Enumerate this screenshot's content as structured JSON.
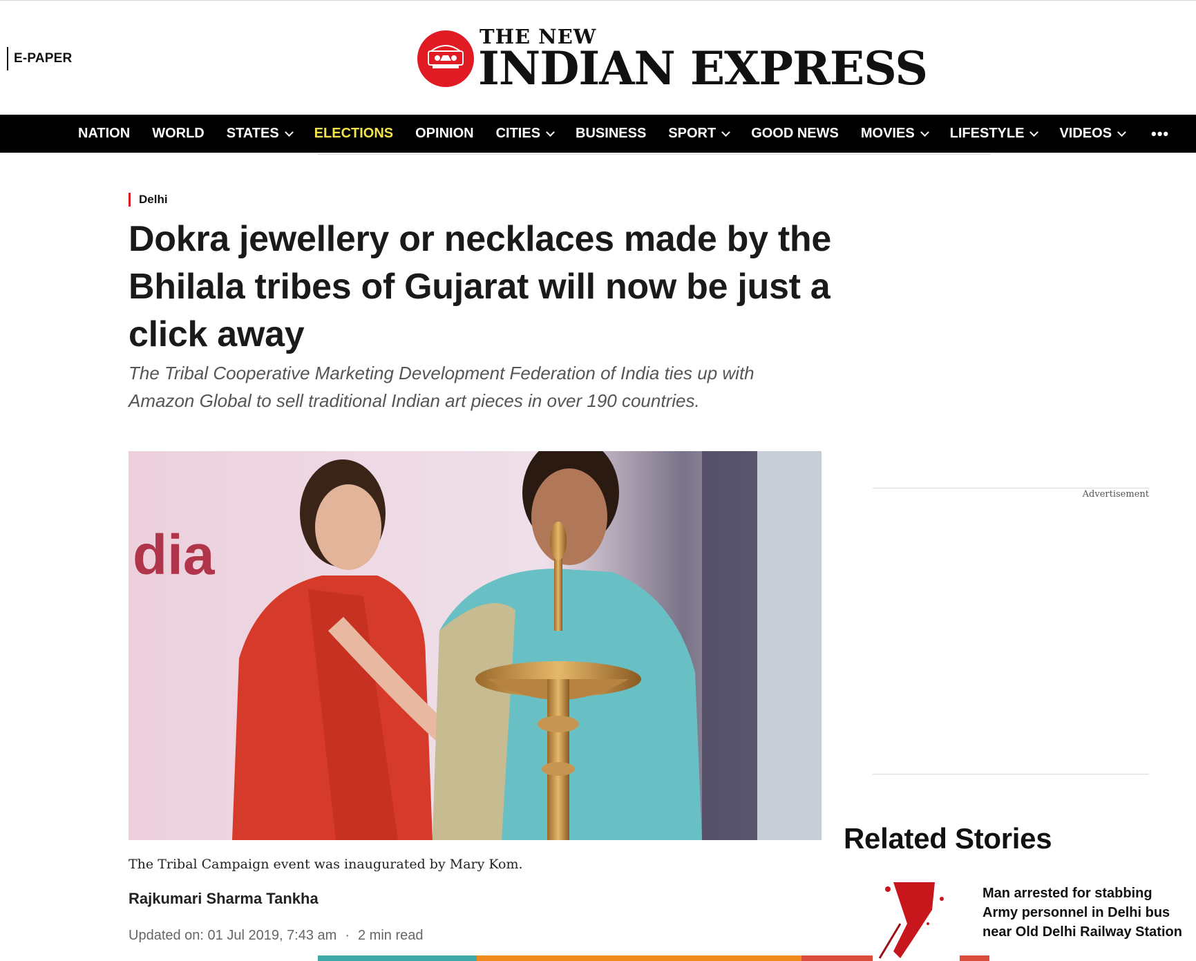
{
  "header": {
    "epaper_label": "E-PAPER",
    "logo_line1": "THE NEW",
    "logo_line2": "INDIAN EXPRESS"
  },
  "nav": {
    "items": [
      {
        "label": "NATION",
        "dropdown": false
      },
      {
        "label": "WORLD",
        "dropdown": false
      },
      {
        "label": "STATES",
        "dropdown": true
      },
      {
        "label": "ELECTIONS",
        "dropdown": false,
        "highlight": true
      },
      {
        "label": "OPINION",
        "dropdown": false
      },
      {
        "label": "CITIES",
        "dropdown": true
      },
      {
        "label": "BUSINESS",
        "dropdown": false
      },
      {
        "label": "SPORT",
        "dropdown": true
      },
      {
        "label": "GOOD NEWS",
        "dropdown": false
      },
      {
        "label": "MOVIES",
        "dropdown": true
      },
      {
        "label": "LIFESTYLE",
        "dropdown": true
      },
      {
        "label": "VIDEOS",
        "dropdown": true
      }
    ],
    "more_label": "•••",
    "highlight_color": "#f4e34b"
  },
  "article": {
    "section": "Delhi",
    "headline": "Dokra jewellery or necklaces made by the Bhilala tribes of Gujarat will now be just a click away",
    "subheadline": "The Tribal Cooperative Marketing Development Federation of India ties up with Amazon Global to sell traditional Indian art pieces in over 190 countries.",
    "image_caption": "The Tribal Campaign event was inaugurated by Mary Kom.",
    "author": "Rajkumari Sharma Tankha",
    "updated": "Updated on: 01 Jul 2019, 7:43 am",
    "separator": "·",
    "read_time": "2 min read"
  },
  "sidebar": {
    "ad_label": "Advertisement",
    "related_title": "Related Stories",
    "related_items": [
      {
        "title": "Man arrested for stabbing Army personnel in Delhi bus near Old Delhi Railway Station"
      }
    ]
  },
  "colors": {
    "brand_red": "#e01b24",
    "nav_bg": "#000000"
  }
}
